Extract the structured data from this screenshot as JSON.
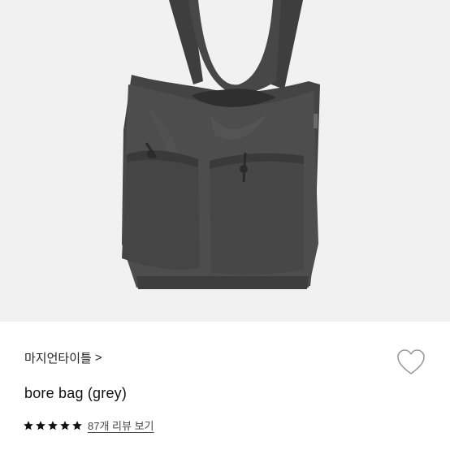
{
  "product": {
    "brand": "마지언타이틀",
    "brand_chevron": ">",
    "title": "bore bag (grey)",
    "rating_stars": 5,
    "reviews_link": "87개 리뷰 보기",
    "image_icon": "tote-bag-image"
  },
  "colors": {
    "image_background": "#f1f1f1",
    "bag": "#4a4a4a",
    "star": "#111111",
    "heart_outline": "#9a9a9a"
  },
  "icons": {
    "wishlist": "heart-icon",
    "rating": "star-icon"
  }
}
